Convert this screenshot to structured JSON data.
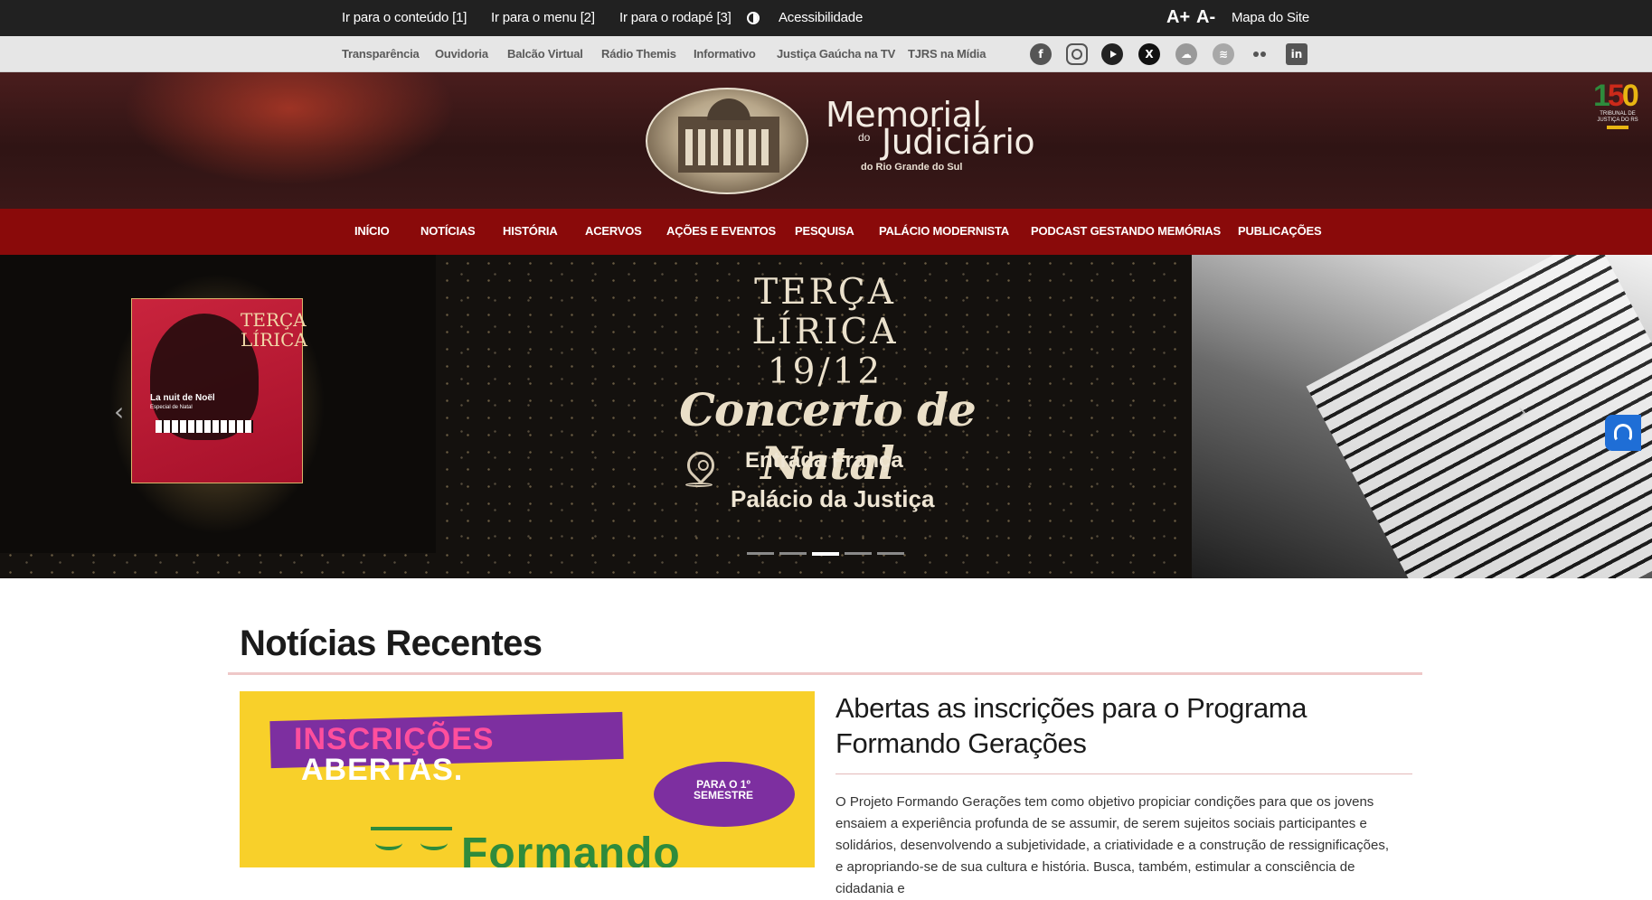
{
  "topbar": {
    "skip_content": "Ir para o conteúdo [1]",
    "skip_menu": "Ir para o menu [2]",
    "skip_footer": "Ir para o rodapé [3]",
    "accessibility": "Acessibilidade",
    "font_increase": "A+",
    "font_decrease": "A-",
    "sitemap": "Mapa do Site"
  },
  "linksbar": {
    "links": [
      "Transparência",
      "Ouvidoria",
      "Balcão Virtual",
      "Rádio Themis",
      "Informativo",
      "Justiça Gaúcha na TV",
      "TJRS na Mídia"
    ],
    "social_icons": [
      "facebook-icon",
      "instagram-icon",
      "youtube-icon",
      "x-icon",
      "soundcloud-icon",
      "spotify-icon",
      "flickr-icon",
      "linkedin-icon"
    ]
  },
  "banner": {
    "logo_line1": "Memorial",
    "logo_line2": "do",
    "logo_line3": "Judiciário",
    "logo_line4": "do Rio Grande do Sul",
    "seal_number": "150",
    "seal_label": "TRIBUNAL DE JUSTIÇA DO RS"
  },
  "nav": {
    "items": [
      "INÍCIO",
      "NOTÍCIAS",
      "HISTÓRIA",
      "ACERVOS",
      "AÇÕES E EVENTOS",
      "PESQUISA",
      "PALÁCIO MODERNISTA",
      "PODCAST GESTANDO MEMÓRIAS",
      "PUBLICAÇÕES"
    ]
  },
  "carousel": {
    "poster_title_1": "TERÇA",
    "poster_title_2": "LÍRICA",
    "poster_subtitle": "La nuit de Noël",
    "poster_small": "Especial de Natal",
    "title_1": "TERÇA",
    "title_2": "LÍRICA",
    "date": "19/12",
    "script": "Concerto de Natal",
    "entrance": "Entrada França",
    "venue": "Palácio da Justiça",
    "slide_count": 5,
    "active_slide": 3
  },
  "news": {
    "section_title": "Notícias Recentes",
    "image_text_1": "INSCRIÇÕES",
    "image_text_2": "ABERTAS.",
    "image_bubble": "PARA O 1º SEMESTRE",
    "image_text_3": "Formando",
    "headline": "Abertas as inscrições para o Programa Formando Gerações",
    "body": "O Projeto Formando Gerações tem como objetivo propiciar condições para que os jovens ensaiem a experiência profunda de se assumir, de serem sujeitos sociais participantes e solidários, desenvolvendo a subjetividade, a criatividade e a construção de ressignificações, e apropriando-se de sua cultura e história. Busca, também, estimular a consciência de cidadania e"
  },
  "colors": {
    "topbar": "#212121",
    "linksbar": "#e6e6e6",
    "nav": "#8a0a0a",
    "accent_rule": "#efc8c8",
    "vlibras": "#1f6ed6"
  }
}
